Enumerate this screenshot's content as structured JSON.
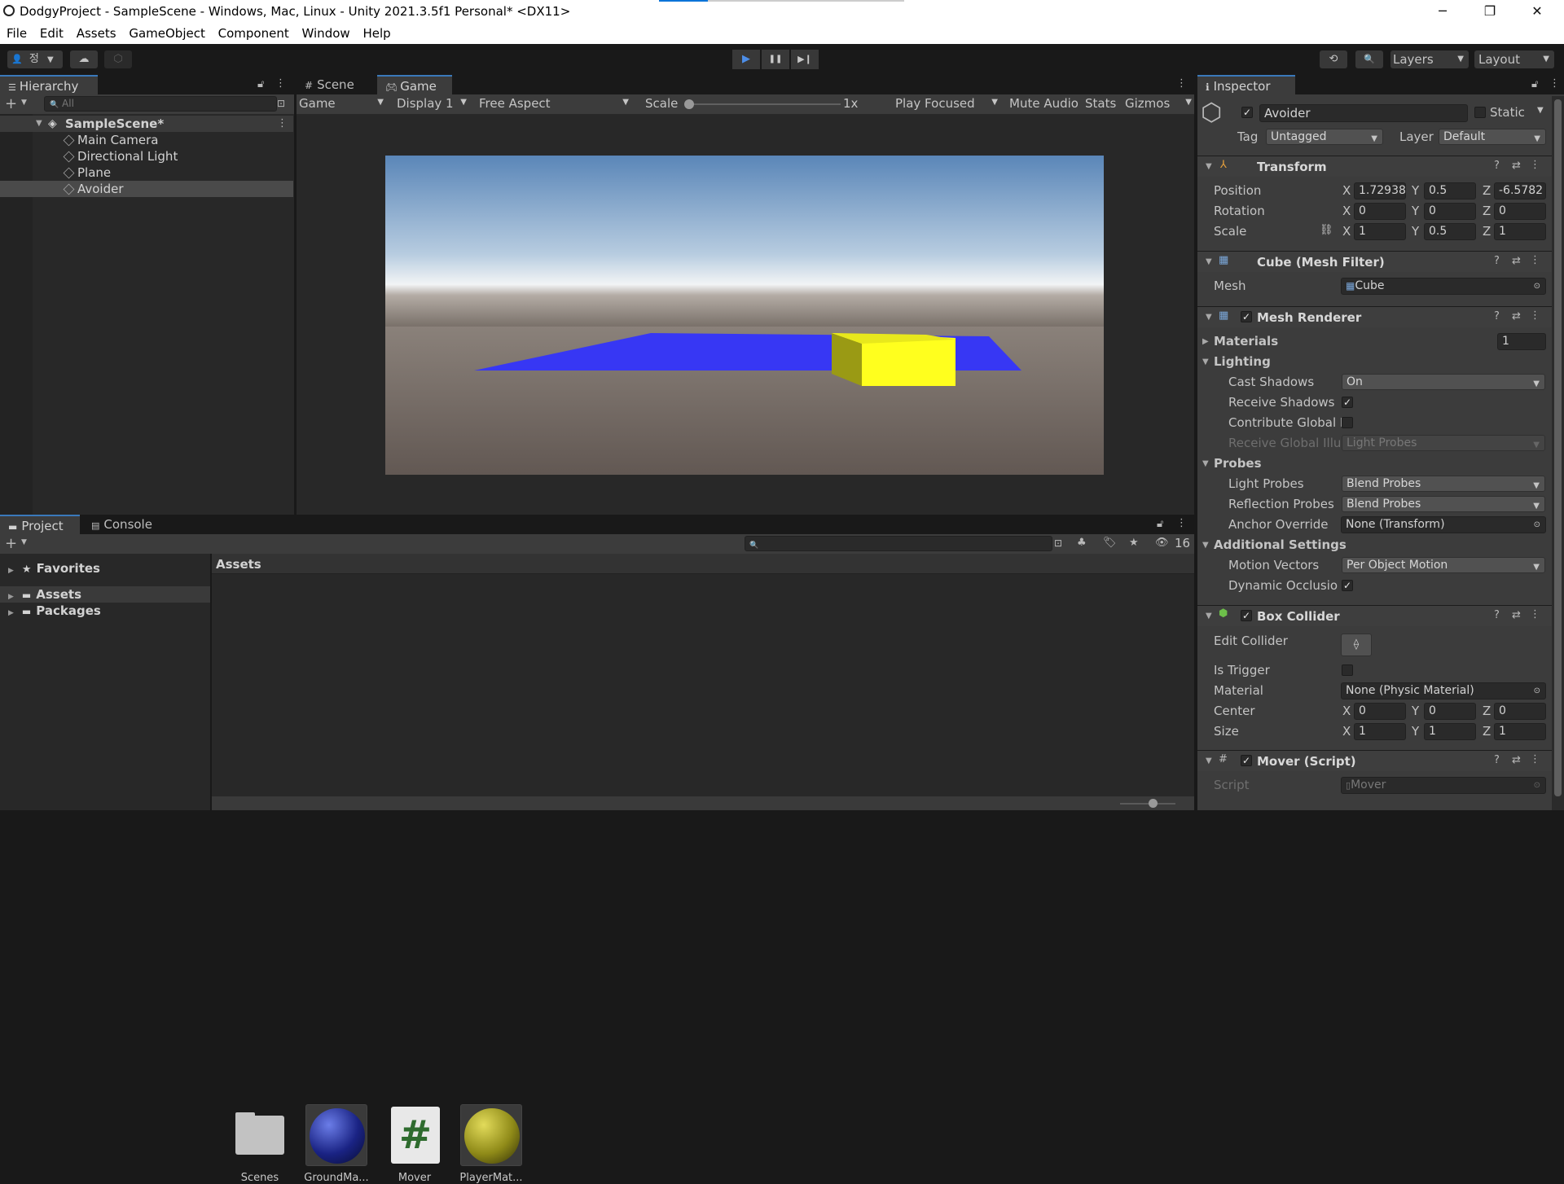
{
  "window": {
    "title": "DodgyProject - SampleScene - Windows, Mac, Linux - Unity 2021.3.5f1 Personal* <DX11>",
    "min": "─",
    "max": "❐",
    "close": "✕"
  },
  "menu": [
    "File",
    "Edit",
    "Assets",
    "GameObject",
    "Component",
    "Window",
    "Help"
  ],
  "toolbar": {
    "account": "👤",
    "account_letter": "정",
    "cloud": "☁",
    "collab": "⬡",
    "play": "▶",
    "pause": "❚❚",
    "step": "▶❙",
    "history": "⟲",
    "search": "🔍",
    "layers": "Layers",
    "layout": "Layout"
  },
  "hierarchy": {
    "tab": "Hierarchy",
    "search_placeholder": "All",
    "scene": "SampleScene*",
    "items": [
      "Main Camera",
      "Directional Light",
      "Plane",
      "Avoider"
    ],
    "selected": "Avoider"
  },
  "view": {
    "tabs": [
      "Scene",
      "Game"
    ],
    "active": "Game",
    "mode": "Game",
    "display": "Display 1",
    "aspect": "Free Aspect",
    "scale_label": "Scale",
    "scale_value": "1x",
    "play_focused": "Play Focused",
    "mute": "Mute Audio",
    "stats": "Stats",
    "gizmos": "Gizmos"
  },
  "project": {
    "tabs": [
      "Project",
      "Console"
    ],
    "favorites": "Favorites",
    "folders": [
      "Assets",
      "Packages"
    ],
    "breadcrumb": "Assets",
    "hidden_count": "16",
    "assets": [
      {
        "name": "Scenes",
        "kind": "folder"
      },
      {
        "name": "GroundMa...",
        "kind": "material-blue"
      },
      {
        "name": "Mover",
        "kind": "script"
      },
      {
        "name": "PlayerMat...",
        "kind": "material-yellow"
      }
    ]
  },
  "inspector": {
    "tab": "Inspector",
    "object_name": "Avoider",
    "static_label": "Static",
    "tag_label": "Tag",
    "tag": "Untagged",
    "layer_label": "Layer",
    "layer": "Default",
    "transform": {
      "title": "Transform",
      "rows": [
        {
          "label": "Position",
          "x": "1.72938",
          "y": "0.5",
          "z": "-6.5782"
        },
        {
          "label": "Rotation",
          "x": "0",
          "y": "0",
          "z": "0"
        },
        {
          "label": "Scale",
          "x": "1",
          "y": "0.5",
          "z": "1"
        }
      ]
    },
    "mesh_filter": {
      "title": "Cube (Mesh Filter)",
      "mesh_label": "Mesh",
      "mesh": "Cube"
    },
    "mesh_renderer": {
      "title": "Mesh Renderer",
      "materials_label": "Materials",
      "materials_count": "1",
      "lighting": "Lighting",
      "cast_shadows_label": "Cast Shadows",
      "cast_shadows": "On",
      "receive_shadows_label": "Receive Shadows",
      "contribute_gi_label": "Contribute Global I",
      "receive_gi_label": "Receive Global Illu",
      "receive_gi": "Light Probes",
      "probes": "Probes",
      "light_probes_label": "Light Probes",
      "light_probes": "Blend Probes",
      "reflection_probes_label": "Reflection Probes",
      "reflection_probes": "Blend Probes",
      "anchor_label": "Anchor Override",
      "anchor": "None (Transform)",
      "additional": "Additional Settings",
      "motion_label": "Motion Vectors",
      "motion": "Per Object Motion",
      "dynamic_occ_label": "Dynamic Occlusio"
    },
    "box_collider": {
      "title": "Box Collider",
      "edit_label": "Edit Collider",
      "trigger_label": "Is Trigger",
      "material_label": "Material",
      "material": "None (Physic Material)",
      "center_label": "Center",
      "center": {
        "x": "0",
        "y": "0",
        "z": "0"
      },
      "size_label": "Size",
      "size": {
        "x": "1",
        "y": "1",
        "z": "1"
      }
    },
    "mover": {
      "title": "Mover (Script)",
      "script_label": "Script",
      "script": "Mover"
    }
  },
  "axis": {
    "x": "X",
    "y": "Y",
    "z": "Z"
  }
}
